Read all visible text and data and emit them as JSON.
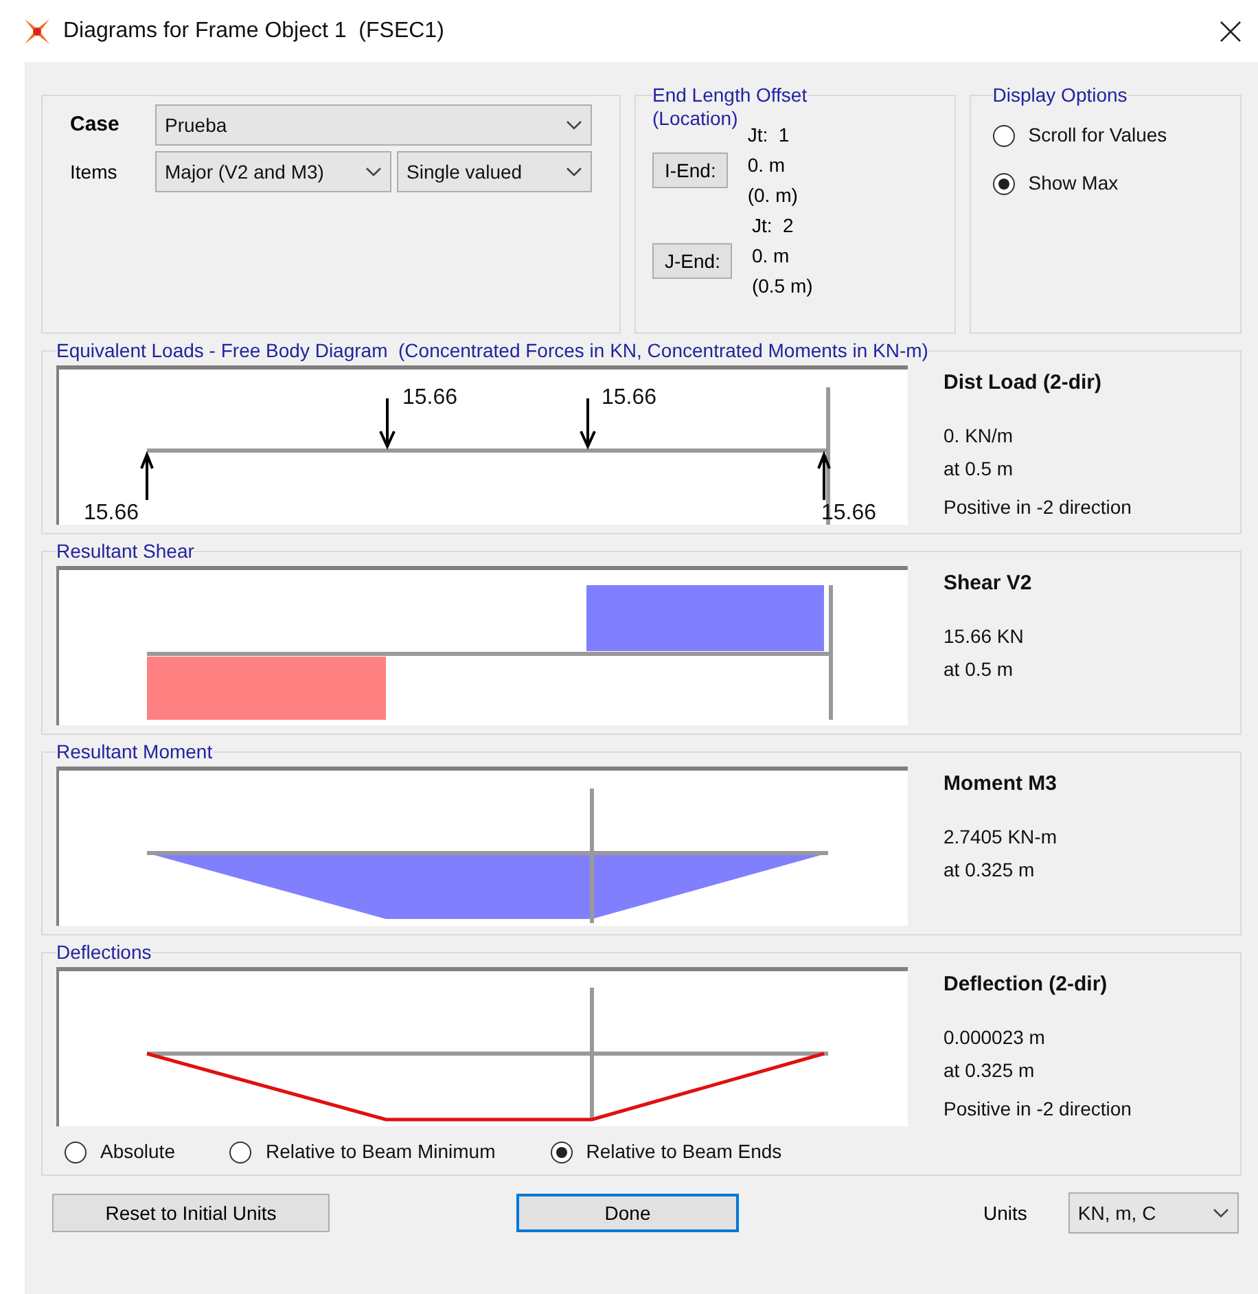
{
  "window": {
    "title": "Diagrams for Frame Object 1  (FSEC1)"
  },
  "case": {
    "label": "Case",
    "value": "Prueba"
  },
  "items": {
    "label": "Items",
    "component": "Major (V2 and M3)",
    "valued": "Single valued"
  },
  "end_length_offset": {
    "title": "End Length Offset",
    "subtitle": "(Location)",
    "ends": [
      {
        "joint": "Jt:  1",
        "button": "I-End:",
        "offset": "0. m",
        "location": "(0. m)"
      },
      {
        "joint": "Jt:  2",
        "button": "J-End:",
        "offset": "0. m",
        "location": "(0.5 m)"
      }
    ]
  },
  "display_options": {
    "title": "Display Options",
    "options": [
      {
        "label": "Scroll for Values",
        "selected": false
      },
      {
        "label": "Show Max",
        "selected": true
      }
    ]
  },
  "panels": [
    {
      "kind": "loads",
      "title": "Equivalent Loads - Free Body Diagram  (Concentrated Forces in KN, Concentrated Moments in KN-m)",
      "labels": [
        "15.66",
        "15.66",
        "15.66",
        "15.66"
      ],
      "info_title": "Dist Load (2-dir)",
      "info": [
        "0. KN/m",
        "at 0.5 m"
      ],
      "note": "Positive in -2 direction"
    },
    {
      "kind": "shear",
      "title": "Resultant Shear",
      "info_title": "Shear V2",
      "info": [
        "15.66 KN",
        "at 0.5 m"
      ]
    },
    {
      "kind": "moment",
      "title": "Resultant Moment",
      "info_title": "Moment M3",
      "info": [
        "2.7405 KN-m",
        "at 0.325 m"
      ]
    },
    {
      "kind": "deflection",
      "title": "Deflections",
      "info_title": "Deflection (2-dir)",
      "info": [
        "0.000023 m",
        "at 0.325 m"
      ],
      "note": "Positive in -2 direction",
      "modes": [
        {
          "label": "Absolute",
          "selected": false
        },
        {
          "label": "Relative to Beam Minimum",
          "selected": false
        },
        {
          "label": "Relative to Beam Ends",
          "selected": true
        }
      ]
    }
  ],
  "footer": {
    "reset": "Reset to Initial Units",
    "done": "Done",
    "units_label": "Units",
    "units": "KN, m, C"
  }
}
